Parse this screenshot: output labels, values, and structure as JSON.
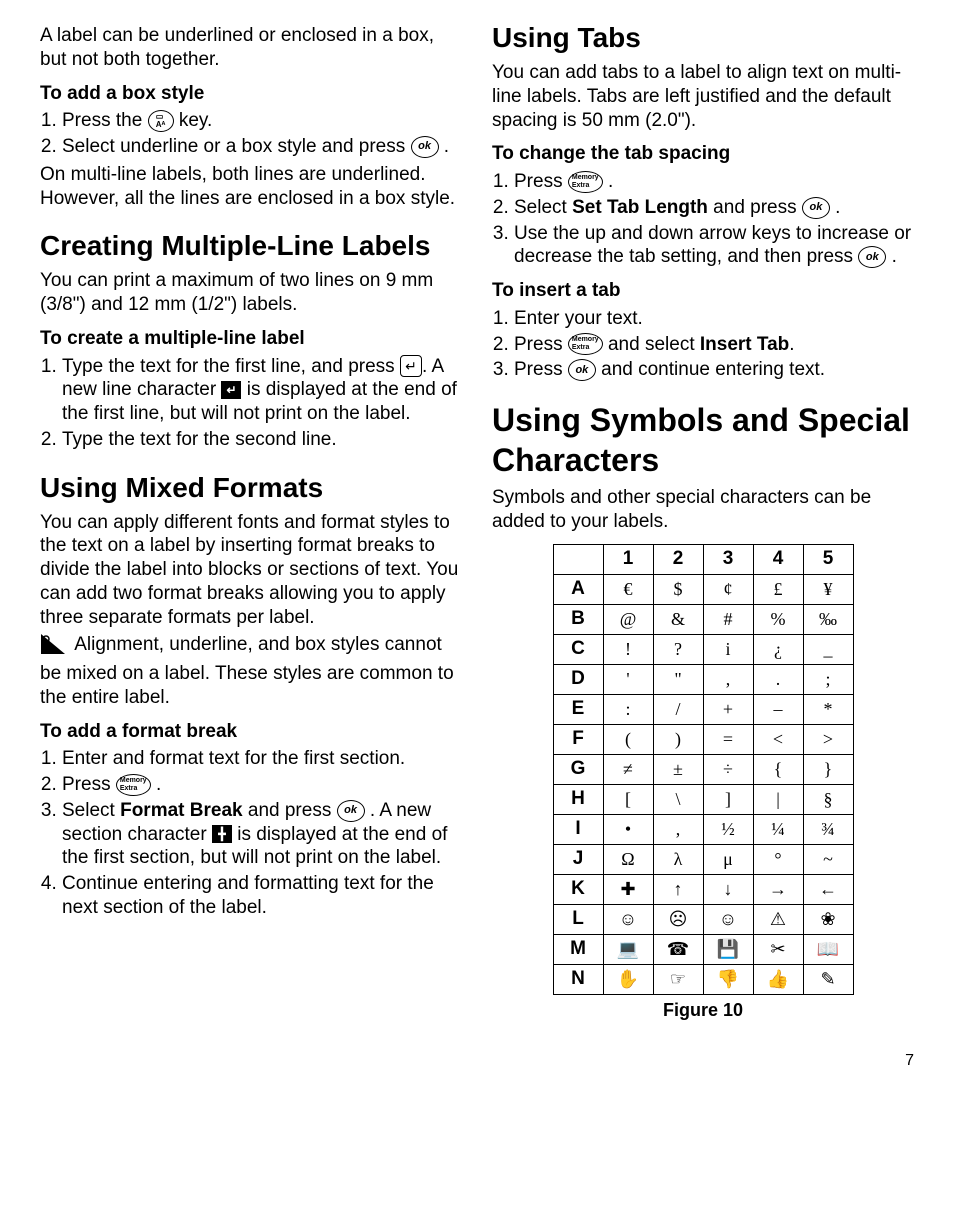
{
  "left": {
    "intro": "A label can be underlined or enclosed in a box, but not both together.",
    "addBoxHead": "To add a box style",
    "addBox1a": "Press the ",
    "addBox1b": " key.",
    "addBox2a": "Select underline or a box style and press ",
    "addBox2b": " .",
    "addBoxNote": "On multi-line labels, both lines are underlined. However, all the lines are enclosed in a box style.",
    "multiHead": "Creating Multiple-Line Labels",
    "multiPara": "You can print a maximum of two lines on 9 mm (3/8\") and 12 mm (1/2\") labels.",
    "createMultiHead": "To create a multiple-line label",
    "createMulti1a": "Type the text for the first line, and press ",
    "createMulti1b": ". A new line character ",
    "createMulti1c": " is displayed at the end of the first line, but will not print on the label.",
    "createMulti2": "Type the text for the second line.",
    "mixedHead": "Using Mixed Formats",
    "mixedPara": "You can apply different fonts and format styles to the text on a label by inserting format breaks to divide the label into blocks or sections of text. You can add two format breaks allowing you to apply three separate formats per label.",
    "mixedNote": " Alignment, underline, and box styles cannot be mixed on a label. These styles are common to the entire label.",
    "fmtBreakHead": "To add a format break",
    "fmtBreak1": "Enter and format text for the first section.",
    "fmtBreak2a": "Press ",
    "fmtBreak2b": " .",
    "fmtBreak3a": "Select ",
    "fmtBreak3bold": "Format Break",
    "fmtBreak3b": " and press ",
    "fmtBreak3c": " . A new section character ",
    "fmtBreak3d": " is displayed at the end of the first section, but will not print on the label.",
    "fmtBreak4": "Continue entering and formatting text for the next section of the label."
  },
  "right": {
    "tabsHead": "Using Tabs",
    "tabsPara": "You can add tabs to a label to align text on multi-line labels. Tabs are left justified and the default spacing is 50 mm (2.0\").",
    "chgTabHead": "To change the tab spacing",
    "chgTab1a": "Press ",
    "chgTab1b": " .",
    "chgTab2a": "Select ",
    "chgTab2bold": "Set Tab Length",
    "chgTab2b": " and press ",
    "chgTab2c": " .",
    "chgTab3a": "Use the up and down arrow keys to increase or decrease the tab setting, and then press ",
    "chgTab3b": " .",
    "insTabHead": "To insert a tab",
    "insTab1": "Enter your text.",
    "insTab2a": "Press ",
    "insTab2b": " and select ",
    "insTab2bold": "Insert Tab",
    "insTab2c": ".",
    "insTab3a": "Press ",
    "insTab3b": " and continue entering text.",
    "symHead": "Using Symbols and Special Characters",
    "symPara": "Symbols and other special characters can be added to your labels.",
    "figCaption": "Figure 10"
  },
  "keys": {
    "boxIcon": "▭",
    "ok": "ok",
    "enter": "↵",
    "newline": "↵",
    "memoryExtra": "Memory Extra",
    "sectionBreak": "╋"
  },
  "chart_data": {
    "type": "table",
    "title": "Figure 10",
    "columns": [
      "1",
      "2",
      "3",
      "4",
      "5"
    ],
    "rows": [
      "A",
      "B",
      "C",
      "D",
      "E",
      "F",
      "G",
      "H",
      "I",
      "J",
      "K",
      "L",
      "M",
      "N"
    ],
    "cells": {
      "A": [
        "€",
        "$",
        "¢",
        "£",
        "¥"
      ],
      "B": [
        "@",
        "&",
        "#",
        "%",
        "‰"
      ],
      "C": [
        "!",
        "?",
        "i",
        "¿",
        "_"
      ],
      "D": [
        "'",
        "\"",
        ",",
        ".",
        ";"
      ],
      "E": [
        ":",
        "/",
        "+",
        "–",
        "*"
      ],
      "F": [
        "(",
        ")",
        "=",
        "<",
        ">"
      ],
      "G": [
        "≠",
        "±",
        "÷",
        "{",
        "}"
      ],
      "H": [
        "[",
        "\\",
        "]",
        "|",
        "§"
      ],
      "I": [
        "•",
        ",",
        "½",
        "¼",
        "¾"
      ],
      "J": [
        "Ω",
        "λ",
        "μ",
        "°",
        "~"
      ],
      "K": [
        "✚",
        "↑",
        "↓",
        "→",
        "←"
      ],
      "L": [
        "☺",
        "☹",
        "☺",
        "⚠",
        "❀"
      ],
      "M": [
        "💻",
        "☎",
        "💾",
        "✂",
        "📖"
      ],
      "N": [
        "✋",
        "☞",
        "👎",
        "👍",
        "✎"
      ]
    }
  },
  "pagenum": "7"
}
